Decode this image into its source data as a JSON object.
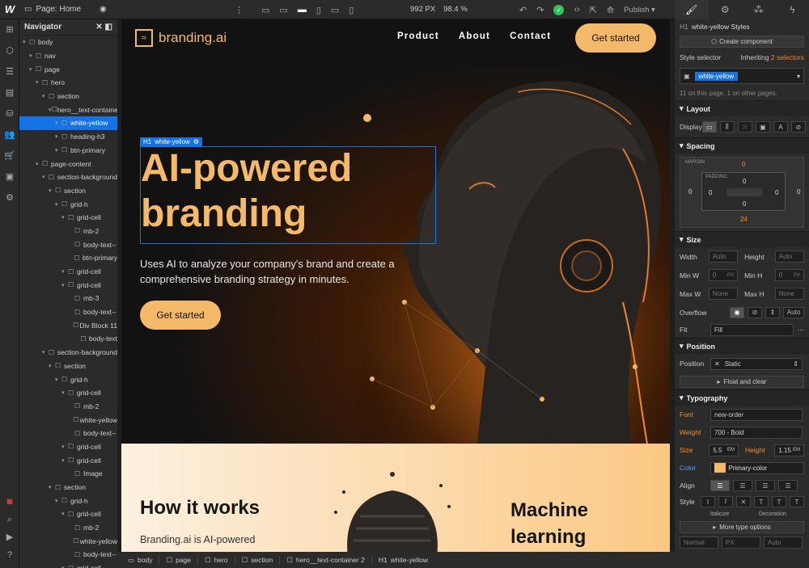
{
  "topbar": {
    "page_label": "Page: Home",
    "width": "992",
    "width_unit": "PX",
    "zoom": "98.4 %",
    "publish": "Publish"
  },
  "navigator": {
    "title": "Navigator",
    "items": [
      {
        "label": "body",
        "depth": 0
      },
      {
        "label": "nav",
        "depth": 1
      },
      {
        "label": "page",
        "depth": 1
      },
      {
        "label": "hero",
        "depth": 2
      },
      {
        "label": "section",
        "depth": 3
      },
      {
        "label": "hero__text-containe",
        "depth": 4
      },
      {
        "label": "white-yellow",
        "depth": 5,
        "selected": true
      },
      {
        "label": "heading-h3",
        "depth": 5
      },
      {
        "label": "btn-primary",
        "depth": 5
      },
      {
        "label": "page-content",
        "depth": 2
      },
      {
        "label": "section-background",
        "depth": 3
      },
      {
        "label": "section",
        "depth": 4
      },
      {
        "label": "grid-h",
        "depth": 5
      },
      {
        "label": "grid-cell",
        "depth": 6
      },
      {
        "label": "mb-2",
        "depth": 7
      },
      {
        "label": "body-text--",
        "depth": 7
      },
      {
        "label": "btn-primary",
        "depth": 7
      },
      {
        "label": "grid-cell",
        "depth": 6
      },
      {
        "label": "grid-cell",
        "depth": 6
      },
      {
        "label": "mb-3",
        "depth": 7
      },
      {
        "label": "body-text--",
        "depth": 7
      },
      {
        "label": "Div Block 11",
        "depth": 7
      },
      {
        "label": "body-text",
        "depth": 8
      },
      {
        "label": "section-background",
        "depth": 3
      },
      {
        "label": "section",
        "depth": 4
      },
      {
        "label": "grid-h",
        "depth": 5
      },
      {
        "label": "grid-cell",
        "depth": 6
      },
      {
        "label": "mb-2",
        "depth": 7
      },
      {
        "label": "white-yellow",
        "depth": 7
      },
      {
        "label": "body-text--",
        "depth": 7
      },
      {
        "label": "grid-cell",
        "depth": 6
      },
      {
        "label": "grid-cell",
        "depth": 6
      },
      {
        "label": "Image",
        "depth": 7
      },
      {
        "label": "section",
        "depth": 4
      },
      {
        "label": "grid-h",
        "depth": 5
      },
      {
        "label": "grid-cell",
        "depth": 6
      },
      {
        "label": "mb-2",
        "depth": 7
      },
      {
        "label": "white-yellow",
        "depth": 7
      },
      {
        "label": "body-text--",
        "depth": 7
      },
      {
        "label": "grid-cell",
        "depth": 6
      }
    ]
  },
  "site": {
    "brand": "branding.ai",
    "menu": [
      "Product",
      "About",
      "Contact"
    ],
    "cta": "Get started",
    "selection_tag": "white-yellow",
    "h1_line1": "AI-powered",
    "h1_line2": "branding",
    "subtitle": "Uses AI to analyze your company's brand and create a comprehensive branding strategy in minutes.",
    "cta2": "Get started",
    "how": "How it works",
    "how_sub": "Branding.ai is AI-powered",
    "ml_line1": "Machine",
    "ml_line2": "learning"
  },
  "breadcrumb": [
    "body",
    "page",
    "hero",
    "section",
    "hero__text-container 2",
    "white-yellow"
  ],
  "style_panel": {
    "element_title": "white-yellow Styles",
    "create_component": "Create component",
    "style_selector": "Style selector",
    "inheriting": "Inheriting",
    "selectors": "2 selectors",
    "class_chip": "white-yellow",
    "usage": "11 on this page, 1 on other pages.",
    "layout": "Layout",
    "display": "Display",
    "spacing": "Spacing",
    "margin": "MARGIN",
    "padding": "PADDING",
    "m_top": "0",
    "p_top": "0",
    "p_left": "0",
    "p_right": "0",
    "p_bottom": "0",
    "m_left": "0",
    "m_right": "0",
    "m_bottom": "24",
    "size": "Size",
    "width": "Width",
    "width_val": "Auto",
    "height": "Height",
    "height_val": "Auto",
    "minw": "Min W",
    "minw_val": "0",
    "minw_unit": "PX",
    "minh": "Min H",
    "minh_val": "0",
    "minh_unit": "PX",
    "maxw": "Max W",
    "maxw_val": "None",
    "maxh": "Max H",
    "maxh_val": "None",
    "overflow": "Overflow",
    "overflow_auto": "Auto",
    "fit": "Fit",
    "fit_val": "Fill",
    "position": "Position",
    "position_label": "Position",
    "position_val": "Static",
    "float": "Float and clear",
    "typography": "Typography",
    "font": "Font",
    "font_val": "new-order",
    "weight": "Weight",
    "weight_val": "700 - Bold",
    "fsize": "Size",
    "fsize_val": "5.5",
    "fsize_unit": "EM",
    "lheight": "Height",
    "lheight_val": "1.15",
    "lheight_unit": "EM",
    "color": "Color",
    "color_val": "Primary-color",
    "color_hex": "#f5b96a",
    "align": "Align",
    "style": "Style",
    "italicize": "Italicize",
    "decoration": "Decoration",
    "more_type": "More type options",
    "bottom_normal": "Normal",
    "bottom_px": "PX",
    "bottom_auto": "Auto"
  },
  "colors": {
    "accent": "#1473e6",
    "brand": "#f5b96a",
    "orange": "#f08c2a"
  }
}
